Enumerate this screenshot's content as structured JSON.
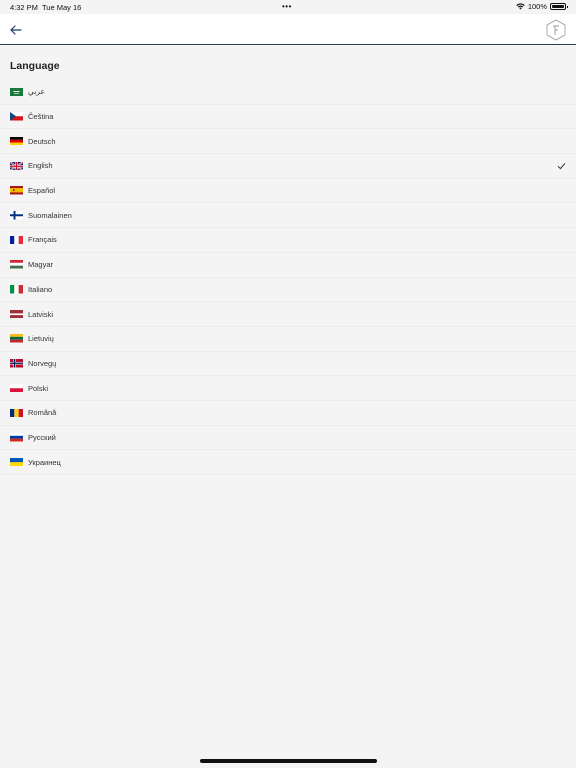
{
  "status": {
    "time": "4:32 PM",
    "date": "Tue May 16",
    "dots": "•••",
    "battery": "100%"
  },
  "nav": {
    "back_icon": "arrow-left-icon",
    "logo_icon": "app-logo-icon"
  },
  "section": {
    "title": "Language"
  },
  "languages": [
    {
      "label": "عربي",
      "flag": "sa",
      "selected": false
    },
    {
      "label": "Čeština",
      "flag": "cz",
      "selected": false
    },
    {
      "label": "Deutsch",
      "flag": "de",
      "selected": false
    },
    {
      "label": "English",
      "flag": "gb",
      "selected": true
    },
    {
      "label": "Español",
      "flag": "es",
      "selected": false
    },
    {
      "label": "Suomalainen",
      "flag": "fi",
      "selected": false
    },
    {
      "label": "Français",
      "flag": "fr",
      "selected": false
    },
    {
      "label": "Magyar",
      "flag": "hu",
      "selected": false
    },
    {
      "label": "Italiano",
      "flag": "it",
      "selected": false
    },
    {
      "label": "Latviski",
      "flag": "lv",
      "selected": false
    },
    {
      "label": "Lietuvių",
      "flag": "lt",
      "selected": false
    },
    {
      "label": "Norvegų",
      "flag": "no",
      "selected": false
    },
    {
      "label": "Polski",
      "flag": "pl",
      "selected": false
    },
    {
      "label": "Română",
      "flag": "ro",
      "selected": false
    },
    {
      "label": "Русский",
      "flag": "ru",
      "selected": false
    },
    {
      "label": "Украинец",
      "flag": "ua",
      "selected": false
    }
  ],
  "colors": {
    "accent": "#1f3a6b",
    "background": "#f4f4f5"
  }
}
